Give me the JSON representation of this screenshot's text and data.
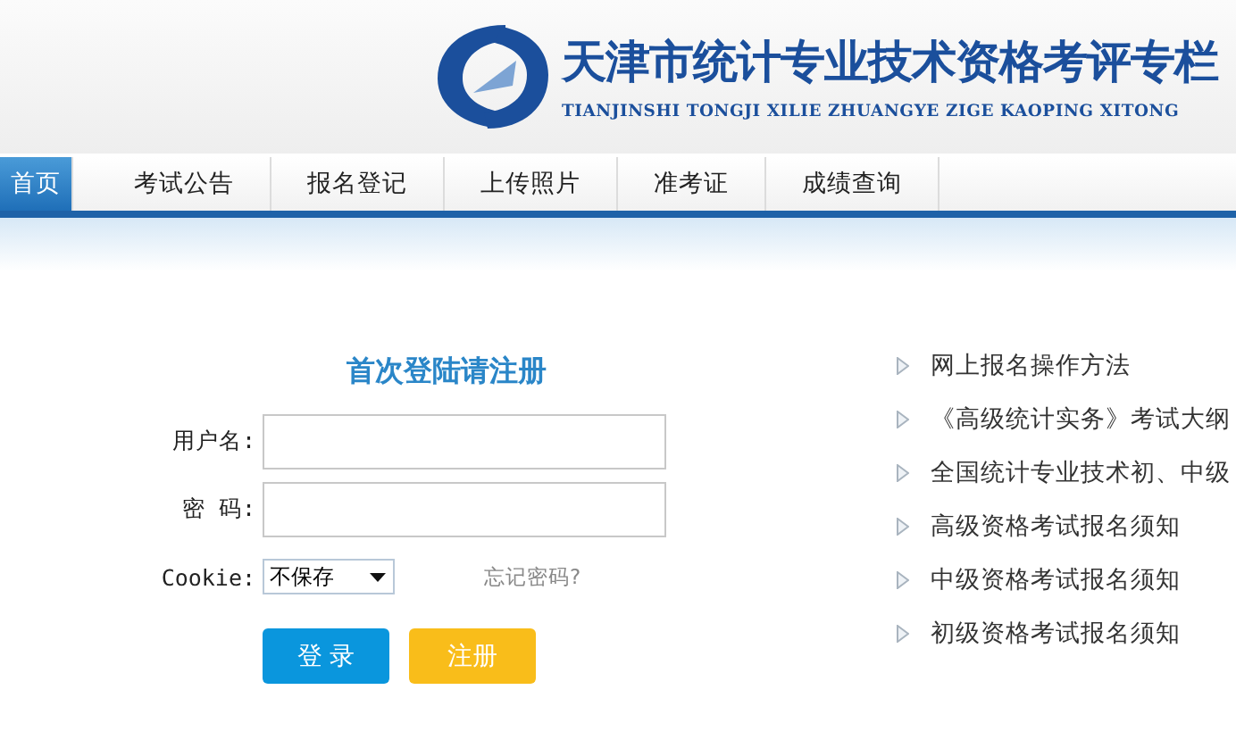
{
  "header": {
    "title": "天津市统计专业技术资格考评专栏",
    "subtitle": "TIANJINSHI TONGJI XILIE ZHUANGYE ZIGE KAOPING XITONG"
  },
  "nav": [
    {
      "label": "首页",
      "selected": true
    },
    {
      "label": "考试公告",
      "selected": false
    },
    {
      "label": "报名登记",
      "selected": false
    },
    {
      "label": "上传照片",
      "selected": false
    },
    {
      "label": "准考证",
      "selected": false
    },
    {
      "label": "成绩查询",
      "selected": false
    }
  ],
  "login": {
    "title": "首次登陆请注册",
    "username_label": "用户名:",
    "password_label": "密 码:",
    "cookie_label": "Cookie:",
    "cookie_value": "不保存",
    "forgot": "忘记密码?",
    "login_button": "登 录",
    "register_button": "注册"
  },
  "links": [
    "网上报名操作方法",
    "《高级统计实务》考试大纲",
    "全国统计专业技术初、中级",
    "高级资格考试报名须知",
    "中级资格考试报名须知",
    "初级资格考试报名须知"
  ]
}
